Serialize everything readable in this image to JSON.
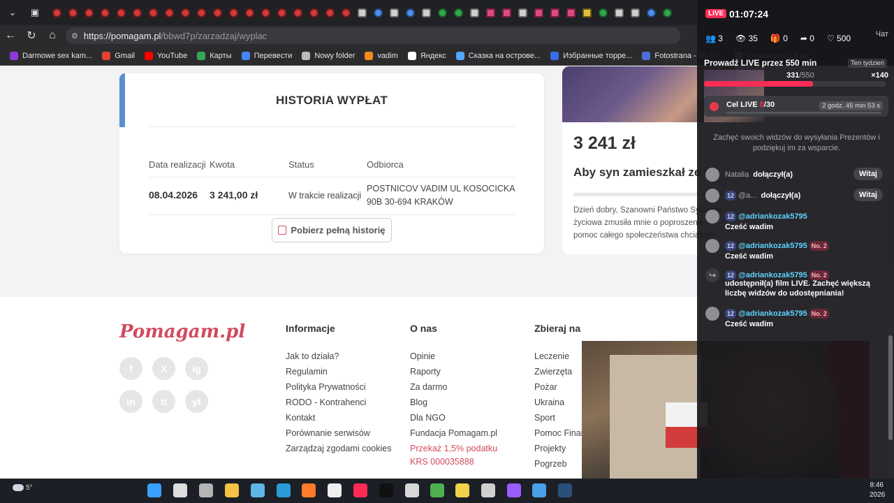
{
  "browser": {
    "url_host": "https://pomagam.pl",
    "url_path": "/bbwd7p/zarzadzaj/wyplac",
    "bookmarks": [
      {
        "label": "Darmowe sex kam...",
        "color": "#8c3bd9"
      },
      {
        "label": "Gmail",
        "color": "#e44134"
      },
      {
        "label": "YouTube",
        "color": "#ff0000"
      },
      {
        "label": "Карты",
        "color": "#34a853"
      },
      {
        "label": "Перевести",
        "color": "#4285f4"
      },
      {
        "label": "Nowy folder",
        "color": "#bbbbbb"
      },
      {
        "label": "vadim",
        "color": "#f28c1e"
      },
      {
        "label": "Яндекс",
        "color": "#ffffff"
      },
      {
        "label": "Сказка на острове...",
        "color": "#55a4ff"
      },
      {
        "label": "Избранные торре...",
        "color": "#3a6ee8"
      },
      {
        "label": "Fotostrana - No Int...",
        "color": "#4b6fd6"
      },
      {
        "label": "Суперпрo (1-6 се...",
        "color": "#888888"
      }
    ]
  },
  "history": {
    "title": "HISTORIA WYPŁAT",
    "columns": [
      "Data realizacji",
      "Kwota",
      "Status",
      "Odbiorca"
    ],
    "row": {
      "date": "08.04.2026",
      "amount": "3 241,00 zł",
      "status": "W trakcie realizacji",
      "recipient_line1": "POSTNICOV VADIM UL KOSOCICKA",
      "recipient_line2": "90B 30-694 KRAKÓW"
    },
    "download_label": "Pobierz pełną historię"
  },
  "campaign": {
    "amount": "3 241 zł",
    "title": "Aby syn zamieszkał ze m",
    "description": "Dzień dobry, Szanowni Państwo Sytuacja życiowa zmusiła mnie o poproszenie o pomoc całego społeczeństwa chciałbym..."
  },
  "footer": {
    "brand": "Pomagam.pl",
    "socials": [
      "f",
      "X",
      "ig",
      "in",
      "tt",
      "yt"
    ],
    "informacje_title": "Informacje",
    "informacje": [
      "Jak to działa?",
      "Regulamin",
      "Polityka Prywatności",
      "RODO - Kontrahenci",
      "Kontakt",
      "Porównanie serwisów",
      "Zarządzaj zgodami cookies"
    ],
    "onas_title": "O nas",
    "onas": [
      "Opinie",
      "Raporty",
      "Za darmo",
      "Blog",
      "Dla NGO",
      "Fundacja Pomagam.pl"
    ],
    "tax_line1": "Przekaż 1,5% podatku",
    "tax_line2": "KRS 000035888",
    "zbieraj_title": "Zbieraj na",
    "zbieraj": [
      "Leczenie",
      "Zwierzęta",
      "Pożar",
      "Ukraina",
      "Sport",
      "Pomoc Finan",
      "Projekty",
      "Pogrzeb"
    ]
  },
  "live": {
    "badge": "LIVE",
    "timer": "01:07:24",
    "followers": "3",
    "viewers": "35",
    "gifts": "0",
    "shares": "0",
    "likes": "500",
    "chat_label": "Чат",
    "goal_title": "Prowadź LIVE przez 550 min",
    "goal_period": "Ten tydzień",
    "goal_current": "331",
    "goal_total": "/550",
    "goal_progress": 0.6,
    "goal_gems": "×140",
    "cel_label": "Cel LIVE ",
    "cel_progress": "0",
    "cel_total": "/30",
    "cel_time": "2 godz. 45 min 53 s",
    "encourage": "Zachęć swoich widzów do wysyłania Prezentów i podziękuj im za wsparcie.",
    "messages": [
      {
        "user": "Natalia",
        "action": "dołączył(a)",
        "button": "Witaj"
      },
      {
        "user": "@a...",
        "badge": "12",
        "action": "dołączył(a)",
        "button": "Witaj"
      },
      {
        "user": "@adriankozak5795",
        "badge": "12",
        "text": "Cześć wadim"
      },
      {
        "user": "@adriankozak5795",
        "badge": "12",
        "rank": "No. 2",
        "text": "Cześć wadim"
      },
      {
        "user": "@adriankozak5795",
        "badge": "12",
        "rank": "No. 2",
        "text": "udostępnił(a) film LIVE. Zachęć większą liczbę widzów do udostępniania!"
      },
      {
        "user": "@adriankozak5795",
        "badge": "12",
        "rank": "No. 2",
        "text": "Cześć wadim"
      }
    ]
  },
  "taskbar": {
    "temp": "5°",
    "time": "8:46",
    "year": "2026"
  }
}
